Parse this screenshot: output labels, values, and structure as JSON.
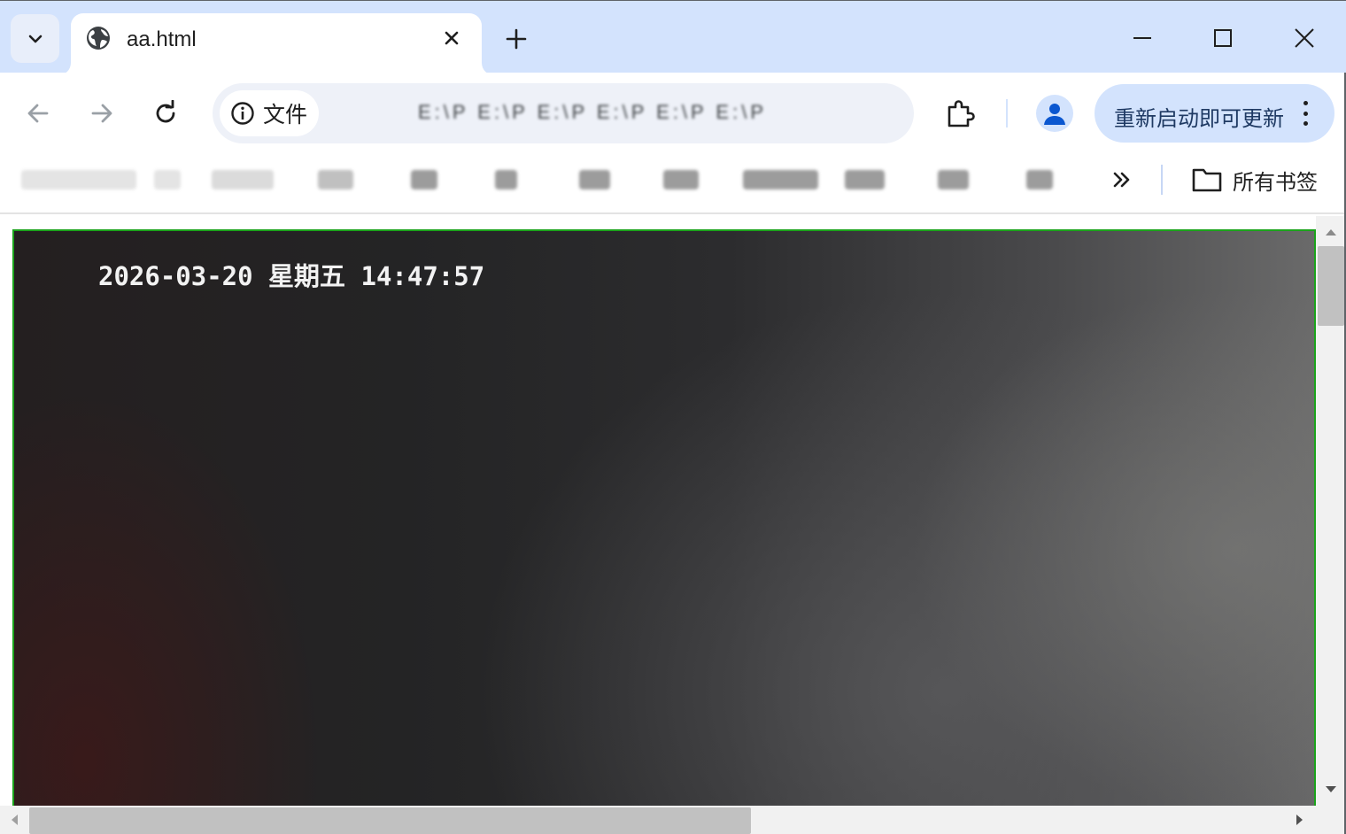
{
  "tab": {
    "title": "aa.html",
    "favicon": "globe-icon"
  },
  "toolbar": {
    "site_chip_label": "文件",
    "url_blurred": "E:\\P E:\\P E:\\P E:\\P E:\\P E:\\P",
    "update_button_label": "重新启动即可更新"
  },
  "bookmarks": {
    "all_bookmarks_label": "所有书签"
  },
  "page": {
    "osd_timestamp": "2026-03-20 星期五 14:47:57"
  },
  "colors": {
    "tabstrip_bg": "#d3e3fd",
    "video_border": "#1ba31b",
    "update_button_bg": "#d3e3fd"
  }
}
